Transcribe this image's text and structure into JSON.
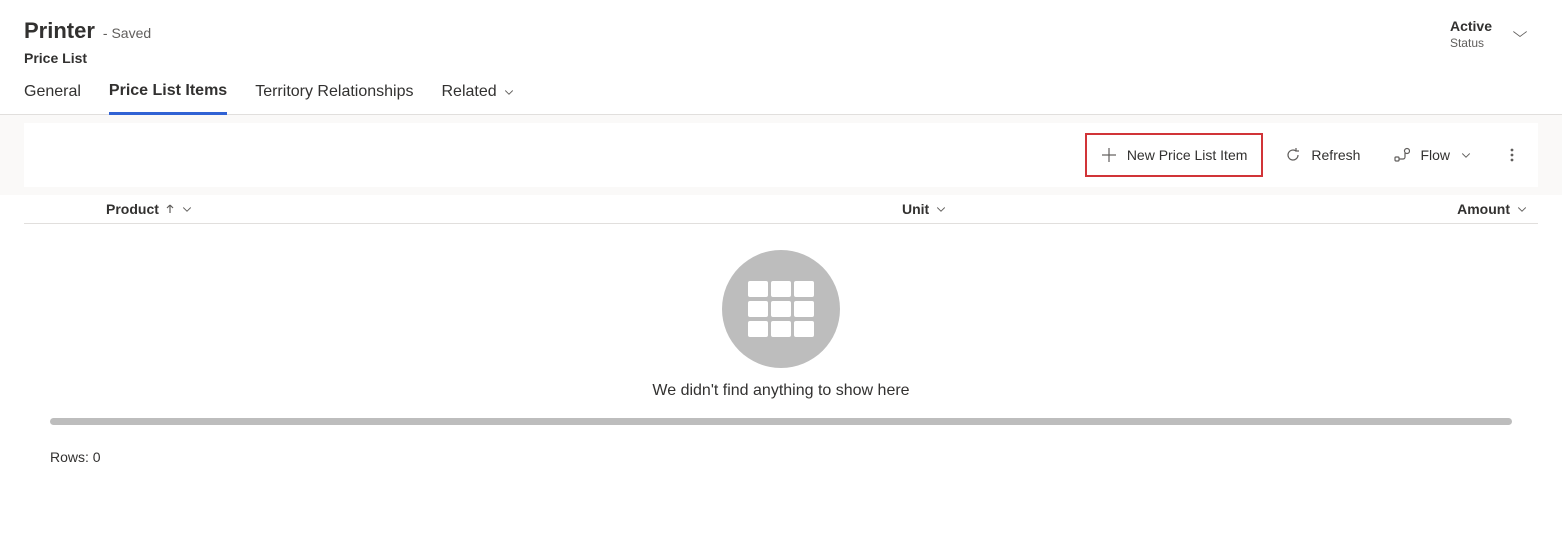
{
  "header": {
    "title": "Printer",
    "saved_text": "- Saved",
    "entity": "Price List",
    "status_value": "Active",
    "status_label": "Status"
  },
  "tabs": {
    "general": "General",
    "price_list_items": "Price List Items",
    "territory": "Territory Relationships",
    "related": "Related"
  },
  "toolbar": {
    "new_item": "New Price List Item",
    "refresh": "Refresh",
    "flow": "Flow"
  },
  "columns": {
    "product": "Product",
    "unit": "Unit",
    "amount": "Amount"
  },
  "empty_state": {
    "message": "We didn't find anything to show here"
  },
  "footer": {
    "rows_label": "Rows: 0"
  }
}
